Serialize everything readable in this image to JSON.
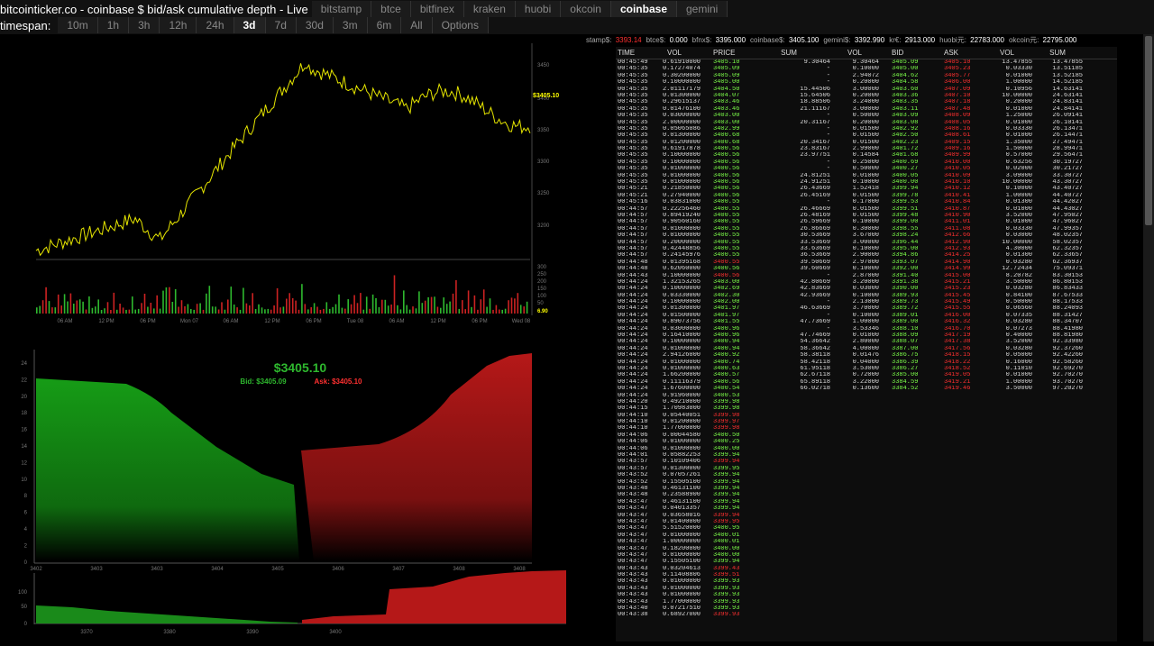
{
  "title": "bitcointicker.co - coinbase $ bid/ask cumulative depth - Live",
  "exchanges": [
    "bitstamp",
    "btce",
    "bitfinex",
    "kraken",
    "huobi",
    "okcoin",
    "coinbase",
    "gemini"
  ],
  "active_exchange": "coinbase",
  "timespan_label": "timespan:",
  "timespans": [
    "10m",
    "1h",
    "3h",
    "12h",
    "24h",
    "3d",
    "7d",
    "30d",
    "3m",
    "6m",
    "All",
    "Options"
  ],
  "active_timespan": "3d",
  "ticker": [
    {
      "label": "stamp$:",
      "value": "3393.14",
      "hl": true
    },
    {
      "label": "btce$:",
      "value": "0.000",
      "hl": false
    },
    {
      "label": "bfnx$:",
      "value": "3395.000",
      "hl": false
    },
    {
      "label": "coinbase$:",
      "value": "3405.100",
      "hl": false
    },
    {
      "label": "gemini$:",
      "value": "3392.990",
      "hl": false
    },
    {
      "label": "kr€:",
      "value": "2913.000",
      "hl": false
    },
    {
      "label": "huobi元:",
      "value": "22783.000",
      "hl": false
    },
    {
      "label": "okcoin元:",
      "value": "22795.000",
      "hl": false
    }
  ],
  "price_chart": {
    "last_label": "$3405.10",
    "y_ticks": [
      "3450",
      "3400",
      "3350",
      "3300",
      "3250",
      "3200"
    ],
    "vol_ticks": [
      "300",
      "250",
      "200",
      "150",
      "100",
      "50",
      "6.90"
    ],
    "x_ticks": [
      "06 AM",
      "12 PM",
      "06 PM",
      "Mon 07",
      "06 AM",
      "12 PM",
      "06 PM",
      "Tue 08",
      "06 AM",
      "12 PM",
      "06 PM",
      "Wed 08"
    ]
  },
  "depth": {
    "price_label": "$3405.10",
    "bid_label": "Bid: $3405.09",
    "ask_label": "Ask: $3405.10",
    "y_ticks": [
      "24",
      "22",
      "20",
      "18",
      "16",
      "14",
      "12",
      "10",
      "8",
      "6",
      "4",
      "2",
      "0"
    ],
    "x_ticks": [
      "3402",
      "3403",
      "3403",
      "3404",
      "3405",
      "3406",
      "3407",
      "3408",
      "3408"
    ],
    "mini_y_ticks": [
      "100",
      "50",
      "0"
    ],
    "mini_x_ticks": [
      "3370",
      "3380",
      "3390",
      "3400"
    ]
  },
  "trades": {
    "headers": [
      "TIME",
      "VOL",
      "PRICE",
      "SUM",
      "VOL",
      "BID",
      "ASK",
      "VOL",
      "SUM"
    ],
    "history": [
      [
        "00:45:49",
        "0.61910000",
        "3405.10",
        "g"
      ],
      [
        "00:45:35",
        "0.17274074",
        "3405.09",
        "g"
      ],
      [
        "00:45:35",
        "0.30200000",
        "3405.09",
        "g"
      ],
      [
        "00:45:35",
        "0.10000000",
        "3405.00",
        "g"
      ],
      [
        "00:45:35",
        "2.01117179",
        "3404.50",
        "g"
      ],
      [
        "00:45:35",
        "0.01300000",
        "3404.07",
        "g"
      ],
      [
        "00:45:35",
        "0.29615137",
        "3403.46",
        "g"
      ],
      [
        "00:45:35",
        "0.01476100",
        "3403.46",
        "g"
      ],
      [
        "00:45:35",
        "0.03000000",
        "3403.00",
        "g"
      ],
      [
        "00:45:35",
        "2.00000000",
        "3403.00",
        "g"
      ],
      [
        "00:45:35",
        "0.05065086",
        "3402.99",
        "g"
      ],
      [
        "00:45:35",
        "0.01300000",
        "3400.68",
        "g"
      ],
      [
        "00:45:35",
        "0.01200000",
        "3400.68",
        "g"
      ],
      [
        "00:45:35",
        "0.61917878",
        "3400.56",
        "g"
      ],
      [
        "00:45:35",
        "0.10000000",
        "3400.56",
        "g"
      ],
      [
        "00:45:35",
        "0.10000000",
        "3400.56",
        "g"
      ],
      [
        "00:45:35",
        "0.01000000",
        "3400.56",
        "g"
      ],
      [
        "00:45:35",
        "0.01000000",
        "3400.56",
        "g"
      ],
      [
        "00:45:35",
        "0.01000000",
        "3400.56",
        "g"
      ],
      [
        "00:45:21",
        "0.21850000",
        "3400.56",
        "g"
      ],
      [
        "00:45:21",
        "0.27940000",
        "3400.56",
        "g"
      ],
      [
        "00:45:16",
        "0.03831000",
        "3400.55",
        "g"
      ],
      [
        "00:44:57",
        "0.22256460",
        "3400.55",
        "g"
      ],
      [
        "00:44:57",
        "0.89419240",
        "3400.55",
        "g"
      ],
      [
        "00:44:57",
        "0.90560160",
        "3400.55",
        "g"
      ],
      [
        "00:44:57",
        "0.01000000",
        "3400.55",
        "g"
      ],
      [
        "00:44:57",
        "0.01000000",
        "3400.55",
        "g"
      ],
      [
        "00:44:57",
        "0.20000000",
        "3400.55",
        "g"
      ],
      [
        "00:44:57",
        "0.42448856",
        "3400.55",
        "g"
      ],
      [
        "00:44:57",
        "0.24145976",
        "3400.55",
        "g"
      ],
      [
        "00:44:48",
        "0.01395168",
        "3400.55",
        "r"
      ],
      [
        "00:44:48",
        "0.62060000",
        "3400.56",
        "g"
      ],
      [
        "00:44:43",
        "0.10000000",
        "3400.56",
        "r"
      ],
      [
        "00:44:24",
        "1.32153265",
        "3403.00",
        "g"
      ],
      [
        "00:44:24",
        "0.10000000",
        "3402.69",
        "g"
      ],
      [
        "00:44:24",
        "0.03330000",
        "3402.30",
        "g"
      ],
      [
        "00:44:24",
        "0.10000000",
        "3402.00",
        "g"
      ],
      [
        "00:44:24",
        "0.01300000",
        "3401.97",
        "g"
      ],
      [
        "00:44:24",
        "0.01500000",
        "3401.97",
        "g"
      ],
      [
        "00:44:24",
        "0.89073756",
        "3401.55",
        "g"
      ],
      [
        "00:44:24",
        "0.03000000",
        "3400.96",
        "g"
      ],
      [
        "00:44:24",
        "0.16410000",
        "3400.96",
        "g"
      ],
      [
        "00:44:24",
        "0.10000000",
        "3400.94",
        "g"
      ],
      [
        "00:44:24",
        "0.01000000",
        "3400.94",
        "g"
      ],
      [
        "00:44:24",
        "2.94126000",
        "3400.92",
        "g"
      ],
      [
        "00:44:24",
        "0.01000000",
        "3400.74",
        "g"
      ],
      [
        "00:44:24",
        "0.01000000",
        "3400.63",
        "g"
      ],
      [
        "00:44:24",
        "1.66200000",
        "3400.57",
        "g"
      ],
      [
        "00:44:24",
        "0.11116379",
        "3400.56",
        "g"
      ],
      [
        "00:44:24",
        "1.67600000",
        "3400.54",
        "g"
      ],
      [
        "00:44:24",
        "0.91960000",
        "3400.53",
        "g"
      ],
      [
        "00:44:20",
        "0.49210000",
        "3399.98",
        "g"
      ],
      [
        "00:44:15",
        "1.70983000",
        "3399.98",
        "g"
      ],
      [
        "00:44:10",
        "0.05440051",
        "3399.98",
        "r"
      ],
      [
        "00:44:10",
        "0.01200000",
        "3399.97",
        "r"
      ],
      [
        "00:44:10",
        "1.77000000",
        "3399.98",
        "r"
      ],
      [
        "00:44:06",
        "0.00044580",
        "3400.50",
        "g"
      ],
      [
        "00:44:06",
        "0.01000000",
        "3400.25",
        "g"
      ],
      [
        "00:44:06",
        "0.01000000",
        "3400.00",
        "g"
      ],
      [
        "00:44:01",
        "0.05882253",
        "3399.94",
        "g"
      ],
      [
        "00:43:57",
        "0.10109406",
        "3399.94",
        "r"
      ],
      [
        "00:43:57",
        "0.01300000",
        "3399.95",
        "g"
      ],
      [
        "00:43:52",
        "0.07057261",
        "3399.94",
        "g"
      ],
      [
        "00:43:52",
        "0.15505100",
        "3399.94",
        "g"
      ],
      [
        "00:43:48",
        "0.46131100",
        "3399.94",
        "g"
      ],
      [
        "00:43:48",
        "0.23588900",
        "3399.94",
        "g"
      ],
      [
        "00:43:47",
        "0.46131100",
        "3399.94",
        "g"
      ],
      [
        "00:43:47",
        "0.04013357",
        "3399.94",
        "g"
      ],
      [
        "00:43:47",
        "0.03658016",
        "3399.94",
        "r"
      ],
      [
        "00:43:47",
        "0.01400000",
        "3399.95",
        "r"
      ],
      [
        "00:43:47",
        "5.51520000",
        "3400.95",
        "g"
      ],
      [
        "00:43:47",
        "0.01000000",
        "3400.01",
        "g"
      ],
      [
        "00:43:47",
        "1.00000000",
        "3400.01",
        "g"
      ],
      [
        "00:43:47",
        "0.18200000",
        "3400.00",
        "g"
      ],
      [
        "00:43:47",
        "0.01000000",
        "3400.00",
        "g"
      ],
      [
        "00:43:47",
        "0.15505100",
        "3399.94",
        "g"
      ],
      [
        "00:43:43",
        "0.03204613",
        "3399.43",
        "r"
      ],
      [
        "00:43:43",
        "0.11408806",
        "3399.51",
        "r"
      ],
      [
        "00:43:43",
        "0.01000000",
        "3399.93",
        "g"
      ],
      [
        "00:43:43",
        "0.01000000",
        "3399.93",
        "g"
      ],
      [
        "00:43:43",
        "0.01000000",
        "3399.93",
        "g"
      ],
      [
        "00:43:43",
        "1.77000000",
        "3399.93",
        "g"
      ],
      [
        "00:43:40",
        "0.07217510",
        "3399.93",
        "g"
      ],
      [
        "00:43:38",
        "0.68927000",
        "3399.93",
        "r"
      ]
    ],
    "book": [
      [
        "9.30464",
        "9.30464",
        "3405.09",
        "3405.10",
        "13.47855",
        "13.47855"
      ],
      [
        "-",
        "0.10000",
        "3405.00",
        "3405.23",
        "0.03330",
        "13.51185"
      ],
      [
        "-",
        "2.94072",
        "3404.62",
        "3405.77",
        "0.01000",
        "13.52185"
      ],
      [
        "-",
        "0.20000",
        "3404.58",
        "3406.00",
        "1.00000",
        "14.52185"
      ],
      [
        "15.44506",
        "3.00000",
        "3403.60",
        "3407.09",
        "0.10956",
        "14.63141"
      ],
      [
        "15.64506",
        "0.20000",
        "3403.36",
        "3407.10",
        "10.00000",
        "24.63141"
      ],
      [
        "18.88506",
        "3.24000",
        "3403.35",
        "3407.18",
        "0.20000",
        "24.83141"
      ],
      [
        "21.11167",
        "3.00000",
        "3403.11",
        "3407.48",
        "0.01000",
        "24.84141"
      ],
      [
        "-",
        "0.50000",
        "3403.09",
        "3408.09",
        "1.25000",
        "26.09141"
      ],
      [
        "20.31167",
        "0.20000",
        "3403.08",
        "3408.05",
        "0.01000",
        "26.10141"
      ],
      [
        "-",
        "0.01500",
        "3402.92",
        "3408.16",
        "0.03330",
        "26.13471"
      ],
      [
        "-",
        "0.01500",
        "3402.50",
        "3408.61",
        "0.01000",
        "26.14471"
      ],
      [
        "20.34167",
        "0.01500",
        "3402.23",
        "3409.15",
        "1.35000",
        "27.49471"
      ],
      [
        "23.83167",
        "2.99000",
        "3401.72",
        "3409.16",
        "1.50000",
        "28.99471"
      ],
      [
        "23.97751",
        "0.14584",
        "3401.68",
        "3409.99",
        "0.57000",
        "29.56471"
      ],
      [
        "-",
        "0.25000",
        "3400.69",
        "3410.00",
        "0.63256",
        "30.19727"
      ],
      [
        "-",
        "0.50000",
        "3400.27",
        "3410.05",
        "0.02000",
        "30.21727"
      ],
      [
        "24.81251",
        "0.01000",
        "3400.05",
        "3410.09",
        "3.09000",
        "33.30727"
      ],
      [
        "24.91251",
        "0.10000",
        "3400.00",
        "3410.10",
        "10.00000",
        "43.30727"
      ],
      [
        "26.43669",
        "1.52418",
        "3399.94",
        "3410.12",
        "0.10000",
        "43.40727"
      ],
      [
        "26.45169",
        "0.01500",
        "3399.78",
        "3410.41",
        "1.00000",
        "44.40727"
      ],
      [
        "-",
        "0.17000",
        "3399.53",
        "3410.84",
        "0.01300",
        "44.42027"
      ],
      [
        "26.46669",
        "0.01500",
        "3399.51",
        "3410.87",
        "0.01000",
        "44.43027"
      ],
      [
        "26.48169",
        "0.01500",
        "3399.48",
        "3410.90",
        "3.52000",
        "47.95027"
      ],
      [
        "26.59669",
        "0.10000",
        "3399.00",
        "3411.01",
        "0.01000",
        "47.96027"
      ],
      [
        "26.86669",
        "0.30000",
        "3398.55",
        "3411.08",
        "0.03330",
        "47.99357"
      ],
      [
        "30.53669",
        "3.67000",
        "3398.24",
        "3412.66",
        "0.03000",
        "48.02357"
      ],
      [
        "33.53669",
        "3.00000",
        "3396.44",
        "3412.90",
        "10.00000",
        "58.02357"
      ],
      [
        "33.63669",
        "0.10000",
        "3395.00",
        "3412.93",
        "4.30000",
        "62.32357"
      ],
      [
        "36.53669",
        "2.90000",
        "3394.86",
        "3414.25",
        "0.01300",
        "62.33657"
      ],
      [
        "39.50669",
        "2.97000",
        "3393.07",
        "3414.90",
        "0.03280",
        "62.36937"
      ],
      [
        "39.60669",
        "0.10000",
        "3392.00",
        "3414.99",
        "12.72434",
        "75.09371"
      ],
      [
        "-",
        "2.87000",
        "3391.40",
        "3415.00",
        "8.20782",
        "83.30153"
      ],
      [
        "42.80669",
        "3.20000",
        "3391.38",
        "3415.21",
        "3.50000",
        "86.80153"
      ],
      [
        "42.83669",
        "0.03000",
        "3390.00",
        "3415.23",
        "0.03280",
        "86.83433"
      ],
      [
        "42.93669",
        "0.10000",
        "3389.93",
        "3415.45",
        "0.84100",
        "87.67533"
      ],
      [
        "-",
        "2.13000",
        "3389.73",
        "3415.49",
        "0.50000",
        "88.17533"
      ],
      [
        "46.63669",
        "3.70000",
        "3389.72",
        "3415.55",
        "0.06560",
        "88.24093"
      ],
      [
        "-",
        "0.10000",
        "3389.01",
        "3416.00",
        "0.07335",
        "88.31427"
      ],
      [
        "47.73669",
        "1.00000",
        "3389.00",
        "3416.32",
        "0.03280",
        "88.34707"
      ],
      [
        "-",
        "3.53346",
        "3388.10",
        "3416.70",
        "0.07273",
        "88.41980"
      ],
      [
        "47.74669",
        "0.01000",
        "3388.09",
        "3417.19",
        "0.40000",
        "88.81980"
      ],
      [
        "54.36642",
        "2.80000",
        "3388.07",
        "3417.38",
        "3.52000",
        "92.33980"
      ],
      [
        "58.36642",
        "4.00000",
        "3387.00",
        "3417.56",
        "0.03280",
        "92.37260"
      ],
      [
        "58.38118",
        "0.01476",
        "3386.75",
        "3418.15",
        "0.05000",
        "92.42260"
      ],
      [
        "58.42118",
        "0.04000",
        "3386.39",
        "3418.22",
        "0.16000",
        "92.58260"
      ],
      [
        "61.95118",
        "3.53000",
        "3386.27",
        "3418.52",
        "0.11010",
        "92.69270"
      ],
      [
        "62.67118",
        "0.72000",
        "3385.00",
        "3419.05",
        "0.01000",
        "92.70270"
      ],
      [
        "65.89118",
        "3.22000",
        "3384.59",
        "3419.21",
        "1.00000",
        "93.70270"
      ],
      [
        "66.02718",
        "0.13600",
        "3384.52",
        "3419.46",
        "3.50000",
        "97.20270"
      ]
    ]
  }
}
